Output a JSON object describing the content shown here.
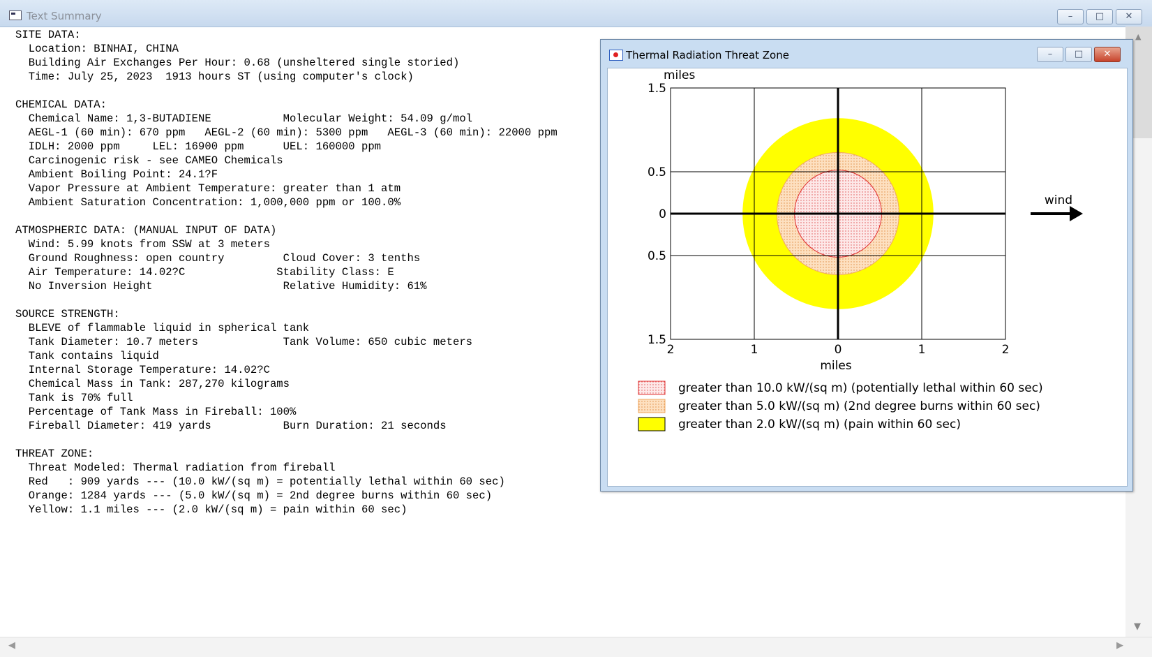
{
  "main_window": {
    "title": "Text Summary",
    "controls": {
      "minimize": "–",
      "maximize": "□",
      "close": "✕"
    }
  },
  "summary_lines": [
    "SITE DATA:",
    "  Location: BINHAI, CHINA",
    "  Building Air Exchanges Per Hour: 0.68 (unsheltered single storied)",
    "  Time: July 25, 2023  1913 hours ST (using computer's clock)",
    "",
    "CHEMICAL DATA:",
    "  Chemical Name: 1,3-BUTADIENE           Molecular Weight: 54.09 g/mol",
    "  AEGL-1 (60 min): 670 ppm   AEGL-2 (60 min): 5300 ppm   AEGL-3 (60 min): 22000 ppm",
    "  IDLH: 2000 ppm     LEL: 16900 ppm      UEL: 160000 ppm",
    "  Carcinogenic risk - see CAMEO Chemicals",
    "  Ambient Boiling Point: 24.1?F",
    "  Vapor Pressure at Ambient Temperature: greater than 1 atm",
    "  Ambient Saturation Concentration: 1,000,000 ppm or 100.0%",
    "",
    "ATMOSPHERIC DATA: (MANUAL INPUT OF DATA)",
    "  Wind: 5.99 knots from SSW at 3 meters",
    "  Ground Roughness: open country         Cloud Cover: 3 tenths",
    "  Air Temperature: 14.02?C              Stability Class: E",
    "  No Inversion Height                    Relative Humidity: 61%",
    "",
    "SOURCE STRENGTH:",
    "  BLEVE of flammable liquid in spherical tank",
    "  Tank Diameter: 10.7 meters             Tank Volume: 650 cubic meters",
    "  Tank contains liquid",
    "  Internal Storage Temperature: 14.02?C",
    "  Chemical Mass in Tank: 287,270 kilograms",
    "  Tank is 70% full",
    "  Percentage of Tank Mass in Fireball: 100%",
    "  Fireball Diameter: 419 yards           Burn Duration: 21 seconds",
    "",
    "THREAT ZONE:",
    "  Threat Modeled: Thermal radiation from fireball",
    "  Red   : 909 yards --- (10.0 kW/(sq m) = potentially lethal within 60 sec)",
    "  Orange: 1284 yards --- (5.0 kW/(sq m) = 2nd degree burns within 60 sec)",
    "  Yellow: 1.1 miles --- (2.0 kW/(sq m) = pain within 60 sec)"
  ],
  "chart_window": {
    "title": "Thermal Radiation Threat Zone",
    "controls": {
      "minimize": "–",
      "maximize": "□",
      "close": "✕"
    }
  },
  "chart_data": {
    "type": "other",
    "xlabel": "miles",
    "ylabel": "miles",
    "x_ticks": [
      "2",
      "1",
      "0",
      "1",
      "2"
    ],
    "x_tick_values": [
      -2,
      -1,
      0,
      1,
      2
    ],
    "y_ticks": [
      "1.5",
      "0.5",
      "0",
      "0.5",
      "1.5"
    ],
    "y_tick_values": [
      1.5,
      0.5,
      0,
      -0.5,
      -1.5
    ],
    "xlim": [
      -2,
      2
    ],
    "ylim": [
      -1.5,
      1.5
    ],
    "wind_label": "wind",
    "zones": [
      {
        "radius_miles": 1.14,
        "color": "#ffff00",
        "pattern": "solid",
        "legend": "greater than 2.0 kW/(sq m) (pain within 60 sec)"
      },
      {
        "radius_miles": 0.73,
        "color": "#fde0c0",
        "pattern": "dots-orange",
        "legend": "greater than 5.0 kW/(sq m) (2nd degree burns within 60 sec)"
      },
      {
        "radius_miles": 0.52,
        "color": "#fde8e8",
        "pattern": "dots-red",
        "legend": "greater than 10.0 kW/(sq m) (potentially lethal within 60 sec)"
      }
    ],
    "legend_order": [
      2,
      1,
      0
    ]
  }
}
